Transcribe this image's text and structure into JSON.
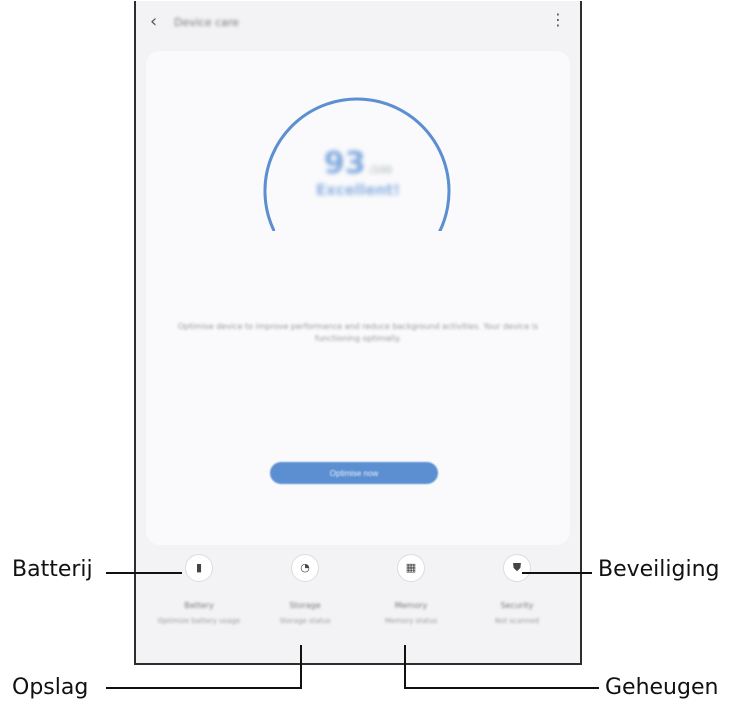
{
  "topbar": {
    "back_glyph": "‹",
    "title": "Device care",
    "more_glyph": "⋮"
  },
  "score": {
    "value": "93",
    "unit": "/100",
    "status": "Excellent!",
    "fraction": 0.93,
    "arc_color": "#5b8fd2"
  },
  "description": "Optimise device to improve performance and reduce background activities. Your device is functioning optimally.",
  "optimize_button": "Optimise now",
  "tiles": [
    {
      "name": "Battery",
      "sub": "Optimize battery usage",
      "icon": "battery-icon",
      "glyph": "▮"
    },
    {
      "name": "Storage",
      "sub": "Storage status",
      "icon": "storage-icon",
      "glyph": "◔"
    },
    {
      "name": "Memory",
      "sub": "Memory status",
      "icon": "memory-icon",
      "glyph": "▦"
    },
    {
      "name": "Security",
      "sub": "Not scanned",
      "icon": "shield-icon",
      "glyph": "⛊"
    }
  ],
  "callouts": {
    "battery": "Batterij",
    "storage": "Opslag",
    "memory": "Geheugen",
    "security": "Beveiliging"
  }
}
